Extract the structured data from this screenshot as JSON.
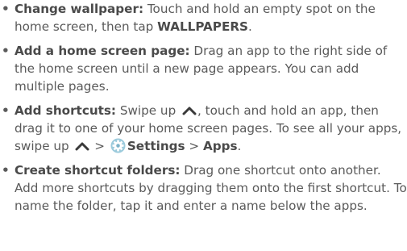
{
  "items": [
    {
      "title": "Change wallpaper:",
      "text1": " Touch and hold an empty spot on the home screen, then tap ",
      "bold1": "WALLPAPERS",
      "text2": "."
    },
    {
      "title": "Add a home screen page:",
      "text1": " Drag an app to the right side of the home screen until a new page appears. You can add multiple pages."
    },
    {
      "title": "Add shortcuts:",
      "text1": " Swipe up ",
      "icon1": "caret-up-icon",
      "text2": ", touch and hold an app, then drag it to one of your home screen pages. To see all your apps, swipe up ",
      "icon2": "caret-up-icon",
      "text3": " > ",
      "icon3": "settings-gear-icon",
      "bold1": "Settings",
      "text4": " > ",
      "bold2": "Apps",
      "text5": "."
    },
    {
      "title": "Create shortcut folders:",
      "text1": " Drag one shortcut onto another. Add more shortcuts by dragging them onto the first shortcut. To name the folder, tap it and enter a name below the apps."
    }
  ],
  "bullet": "•",
  "colors": {
    "text": "#5a5a5a",
    "bold": "#4a4a4a",
    "gear": "#7db3c9"
  }
}
